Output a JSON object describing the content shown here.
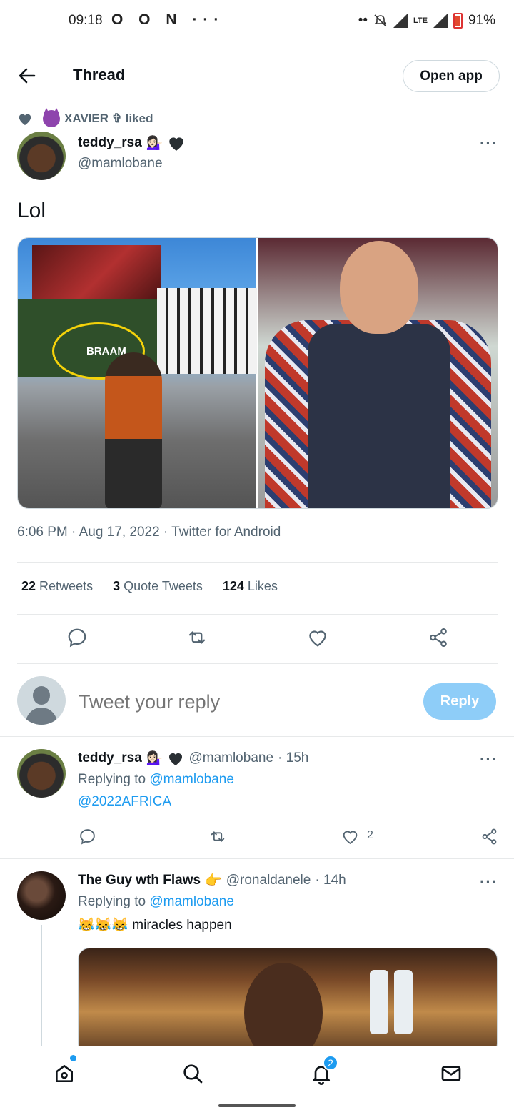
{
  "status_bar": {
    "time": "09:18",
    "left_icons": "O O N ···",
    "right_dots": "••",
    "network": "LTE",
    "battery": "91%"
  },
  "header": {
    "title": "Thread",
    "open_app": "Open app"
  },
  "social_context": {
    "liker": "XAVIER ✞",
    "action": "liked"
  },
  "main_tweet": {
    "name": "teddy_rsa",
    "name_emoji": "💁🏻‍♀️",
    "handle": "@mamlobane",
    "text": "Lol",
    "image_caption": "BRAAM",
    "meta": "6:06 PM · Aug 17, 2022 · Twitter for Android",
    "stats": {
      "retweets_count": "22",
      "retweets_label": "Retweets",
      "quotes_count": "3",
      "quotes_label": "Quote Tweets",
      "likes_count": "124",
      "likes_label": "Likes"
    }
  },
  "reply_box": {
    "placeholder": "Tweet your reply",
    "button": "Reply"
  },
  "replies": [
    {
      "name": "teddy_rsa",
      "name_emoji": "💁🏻‍♀️",
      "handle": "@mamlobane",
      "time": "· 15h",
      "replying_prefix": "Replying to",
      "replying_to": "@mamlobane",
      "text": "@2022AFRICA",
      "likes": "2"
    },
    {
      "name": "The Guy wth Flaws",
      "name_emoji": "👉",
      "handle": "@ronaldanele",
      "time": "· 14h",
      "replying_prefix": "Replying to",
      "replying_to": "@mamlobane",
      "text_emoji": "😹😹😹",
      "text": "miracles happen"
    }
  ],
  "bottom_nav": {
    "notifications_badge": "2"
  },
  "colors": {
    "accent": "#1d9bf0",
    "reply_button": "#8ecdf8",
    "muted": "#536471"
  }
}
